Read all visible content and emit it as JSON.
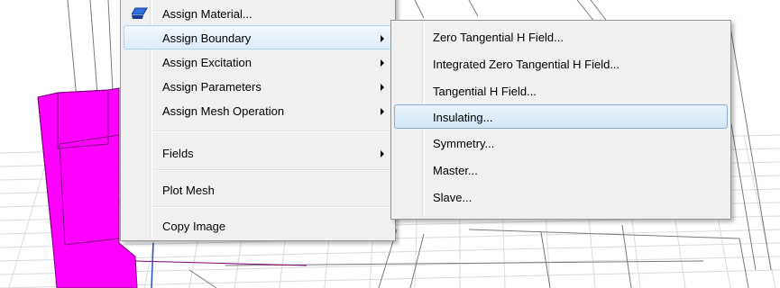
{
  "context_menu": {
    "items": [
      {
        "label": "Assign Material...",
        "has_submenu": false
      },
      {
        "label": "Assign Boundary",
        "has_submenu": true
      },
      {
        "label": "Assign Excitation",
        "has_submenu": true
      },
      {
        "label": "Assign Parameters",
        "has_submenu": true
      },
      {
        "label": "Assign Mesh Operation",
        "has_submenu": true
      },
      {
        "label": "Fields",
        "has_submenu": true
      },
      {
        "label": "Plot Mesh",
        "has_submenu": false
      },
      {
        "label": "Copy Image",
        "has_submenu": false
      }
    ],
    "highlighted": "Assign Boundary"
  },
  "boundary_submenu": {
    "items": [
      {
        "label": "Zero Tangential H Field..."
      },
      {
        "label": "Integrated Zero Tangential H Field..."
      },
      {
        "label": "Tangential H Field..."
      },
      {
        "label": "Insulating..."
      },
      {
        "label": "Symmetry..."
      },
      {
        "label": "Master..."
      },
      {
        "label": "Slave..."
      }
    ],
    "highlighted": "Insulating..."
  },
  "icons": {
    "assign_material": "material-icon",
    "submenu_arrow": "chevron-right-icon"
  },
  "colors": {
    "model_object": "#ff00ff",
    "menu_background": "#f0f0f0",
    "highlight_border": "#8ab2d6"
  }
}
